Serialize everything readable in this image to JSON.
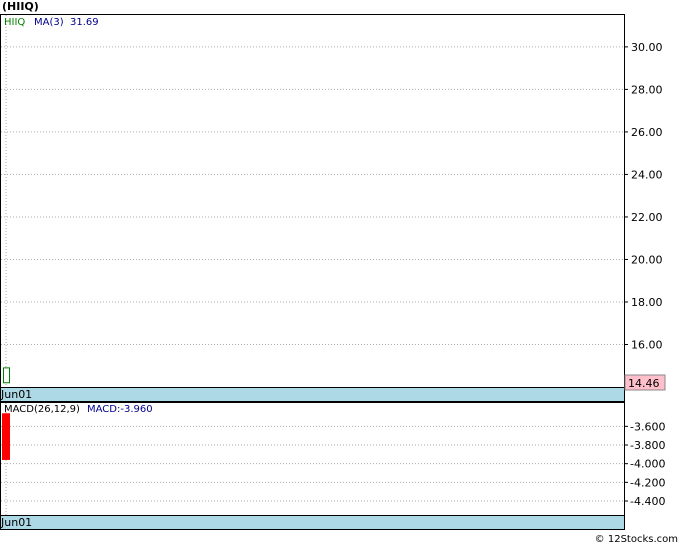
{
  "chart_data": [
    {
      "type": "candlestick",
      "title": "(HIIQ)",
      "legend_symbol": "HIIQ",
      "legend_ma": "MA(3)",
      "legend_ma_value": "31.69",
      "ylim": [
        14.0,
        31.5
      ],
      "y_ticks": [
        "30.00",
        "28.00",
        "26.00",
        "24.00",
        "22.00",
        "20.00",
        "18.00",
        "16.00"
      ],
      "last_price_label": "14.46",
      "x_label": "Jun01",
      "candles": [
        {
          "date": "Jun01",
          "open": 14.2,
          "close": 14.9,
          "high": 14.9,
          "low": 14.2
        }
      ],
      "colors": {
        "up": "#008000",
        "axis_band": "#add8e6",
        "price_tag": "#ffc0cb",
        "ma": "#00008b"
      }
    },
    {
      "type": "bar",
      "title": "MACD(26,12,9)",
      "legend_macd": "MACD:-3.960",
      "ylim": [
        -4.55,
        -3.35
      ],
      "y_ticks": [
        "-3.600",
        "-3.800",
        "-4.000",
        "-4.200",
        "-4.400"
      ],
      "x_label": "Jun01",
      "bars": [
        {
          "date": "Jun01",
          "top": -3.46,
          "bottom": -3.96
        }
      ],
      "colors": {
        "bar": "#ff0000"
      }
    }
  ],
  "footer": {
    "copyright": "© 12Stocks.com"
  }
}
